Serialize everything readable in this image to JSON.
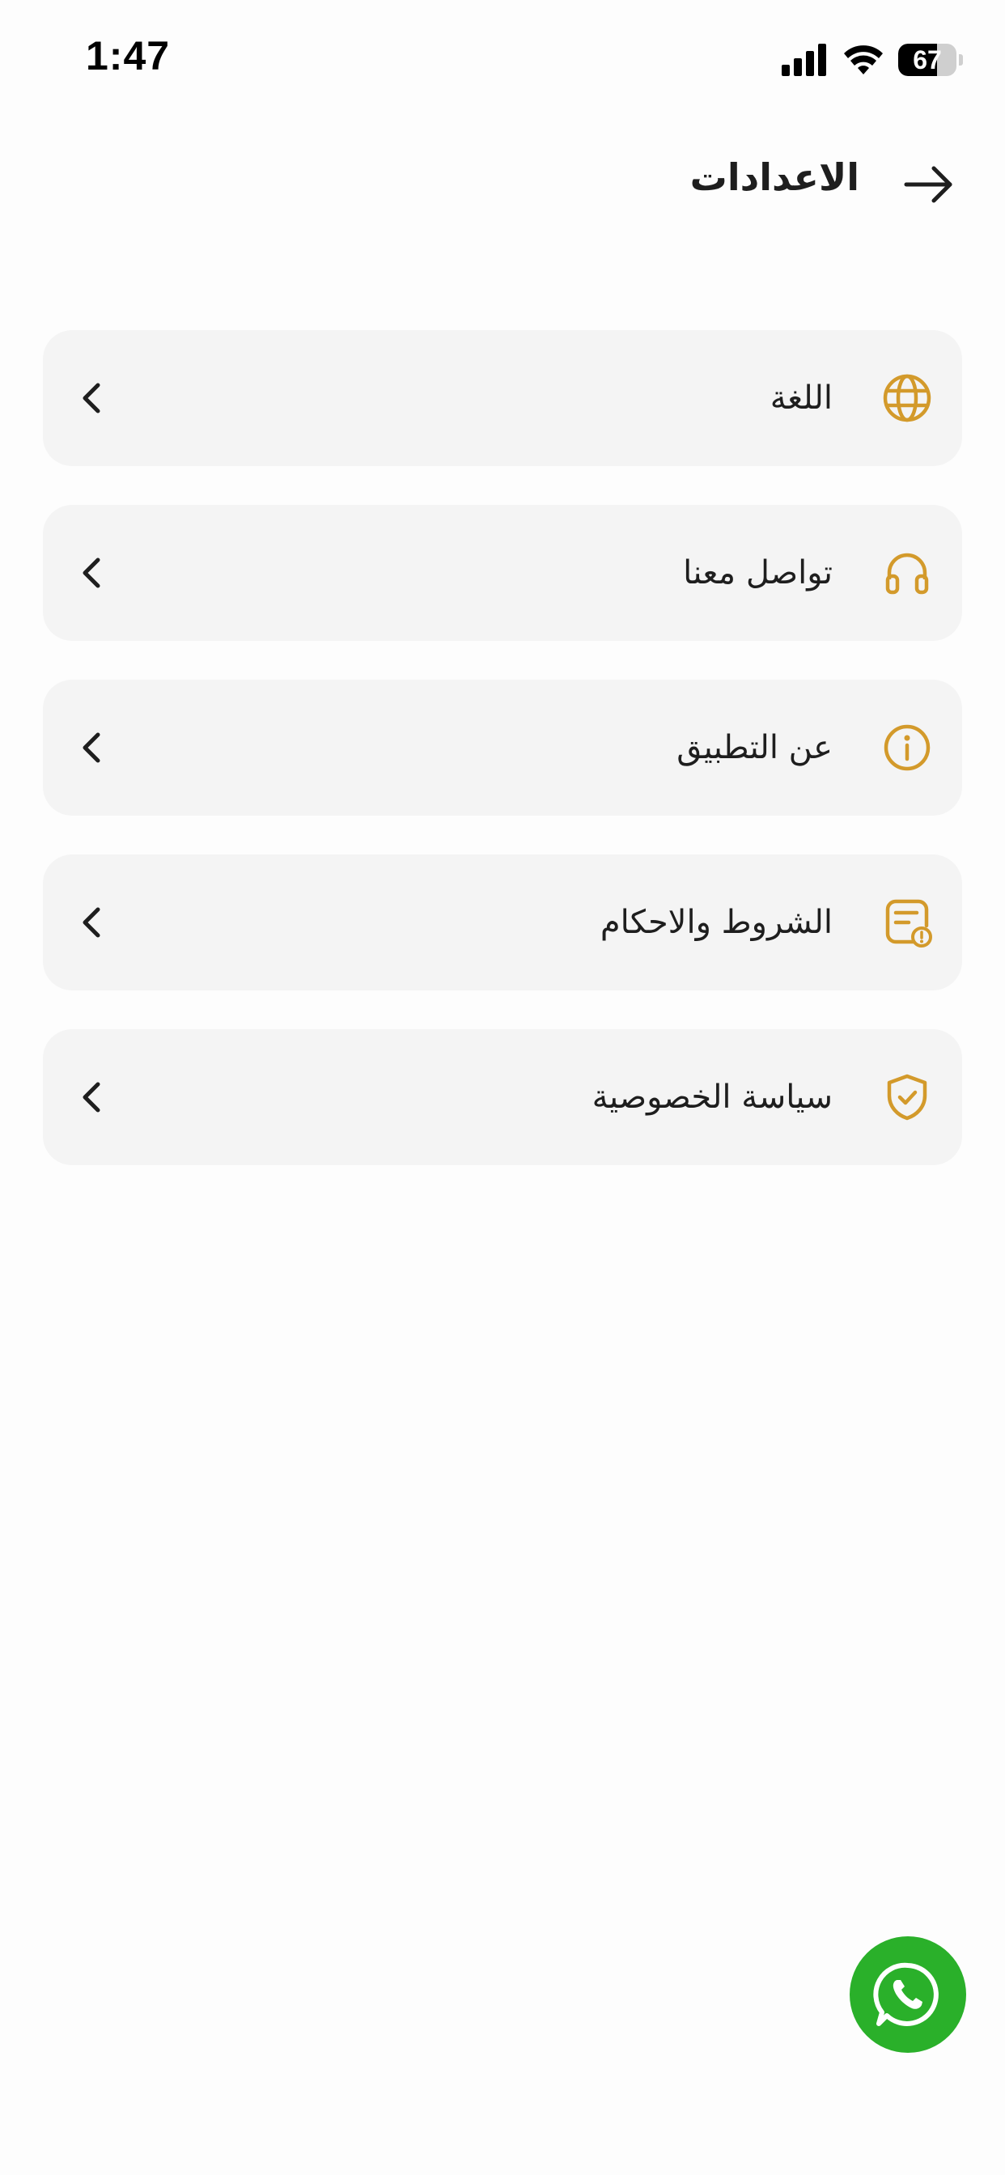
{
  "status_bar": {
    "time": "1:47",
    "battery_level": 67,
    "battery_label": "67"
  },
  "header": {
    "title": "الاعدادات",
    "back_icon": "arrow-right-icon"
  },
  "accent_color": "#d39a2b",
  "settings": [
    {
      "label": "اللغة",
      "icon": "globe-icon"
    },
    {
      "label": "تواصل معنا",
      "icon": "headphones-icon"
    },
    {
      "label": "عن التطبيق",
      "icon": "info-icon"
    },
    {
      "label": "الشروط والاحكام",
      "icon": "document-alert-icon"
    },
    {
      "label": "سياسة الخصوصية",
      "icon": "shield-check-icon"
    }
  ],
  "fab": {
    "icon": "whatsapp-icon",
    "color": "#2ab02a"
  }
}
